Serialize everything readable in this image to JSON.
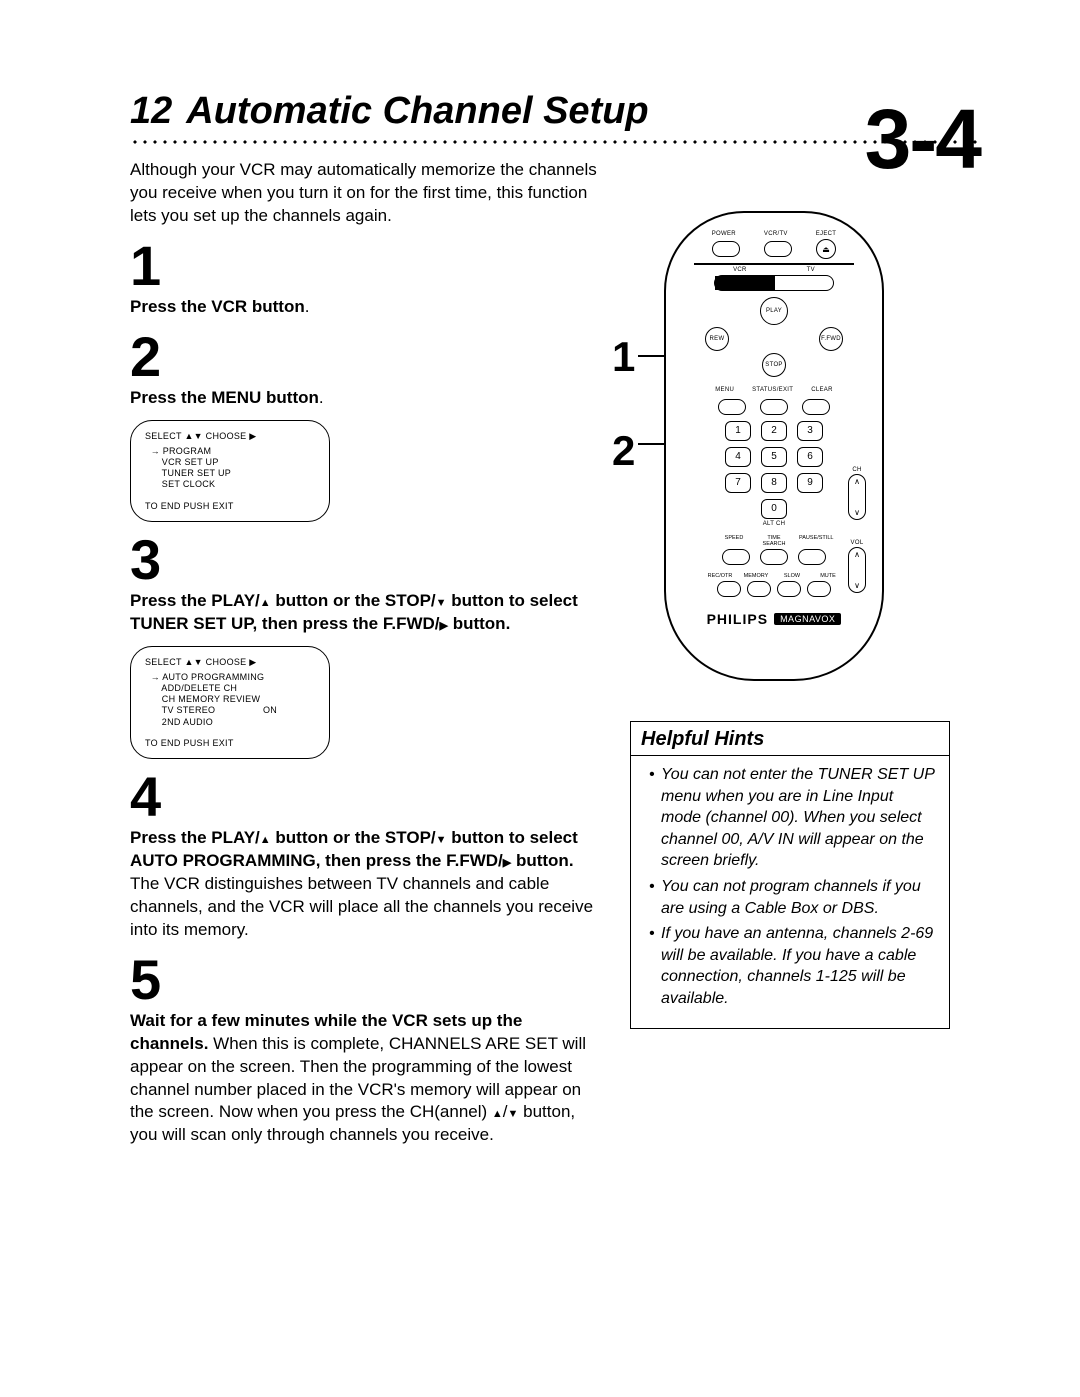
{
  "page_number": "12",
  "title": "Automatic Channel Setup",
  "intro": "Although your VCR may automatically memorize the channels you receive when you turn it on for the first time, this function lets you set up the channels again.",
  "range_label": "3-4",
  "callouts": {
    "one": "1",
    "two": "2"
  },
  "steps": {
    "s1": {
      "num": "1",
      "bold": "Press the VCR button",
      "tail": "."
    },
    "s2": {
      "num": "2",
      "bold": "Press the MENU button",
      "tail": "."
    },
    "s3": {
      "num": "3",
      "bold_a": "Press the PLAY/",
      "bold_b": " button or the STOP/",
      "bold_c": " button to select TUNER SET UP, then press the F.FWD/",
      "bold_d": " button."
    },
    "s4": {
      "num": "4",
      "bold_a": "Press the PLAY/",
      "bold_b": " button or the STOP/",
      "bold_c": " button to select AUTO PROGRAMMING, then press the F.FWD/",
      "bold_d": " button.",
      "tail": " The VCR distinguishes between TV channels and cable channels, and the VCR will place all the channels you receive into its memory."
    },
    "s5": {
      "num": "5",
      "bold": "Wait for a few minutes while the VCR sets up the channels.",
      "tail_a": " When this is complete, CHANNELS ARE SET will appear on the screen. Then the programming of the lowest channel number placed in the VCR's memory will appear on the screen. Now when you press the CH(annel) ",
      "tail_b": " button, you will scan only through channels you receive."
    }
  },
  "osd1": {
    "header": "SELECT ▲▼  CHOOSE ▶",
    "l1": "  → PROGRAM",
    "l2": "      VCR SET UP",
    "l3": "      TUNER SET UP",
    "l4": "      SET CLOCK",
    "footer": "TO END PUSH EXIT"
  },
  "osd2": {
    "header": "SELECT ▲▼  CHOOSE ▶",
    "l1": "  → AUTO PROGRAMMING",
    "l2": "      ADD/DELETE CH",
    "l3": "      CH MEMORY REVIEW",
    "l4": "      TV STEREO                 ON",
    "l5": "      2ND AUDIO",
    "footer": "TO END PUSH EXIT"
  },
  "remote": {
    "labels": {
      "power": "POWER",
      "vcrtv": "VCR/TV",
      "eject": "EJECT",
      "vcr": "VCR",
      "tv": "TV",
      "play": "PLAY",
      "rew": "REW",
      "ffwd": "F.FWD",
      "stop": "STOP",
      "menu": "MENU",
      "status": "STATUS/EXIT",
      "clear": "CLEAR",
      "ch": "CH",
      "altch": "ALT CH",
      "vol": "VOL",
      "speed": "SPEED",
      "timesearch": "TIME SEARCH",
      "pausestill": "PAUSE/STILL",
      "recotr": "REC/OTR",
      "memory": "MEMORY",
      "slow": "SLOW",
      "mute": "MUTE"
    },
    "keypad": [
      "1",
      "2",
      "3",
      "4",
      "5",
      "6",
      "7",
      "8",
      "9",
      "0"
    ],
    "eject_glyph": "⏏",
    "brand_a": "PHILIPS",
    "brand_b": "MAGNAVOX"
  },
  "hints": {
    "title": "Helpful Hints",
    "items": [
      "You can not enter the TUNER SET UP menu when you are in Line Input mode (channel 00). When you select channel 00, A/V IN will appear on the screen briefly.",
      "You can not program channels if you are using a Cable Box or DBS.",
      "If you have an antenna, channels 2-69 will be available. If you have a cable connection, channels 1-125 will be available."
    ]
  }
}
